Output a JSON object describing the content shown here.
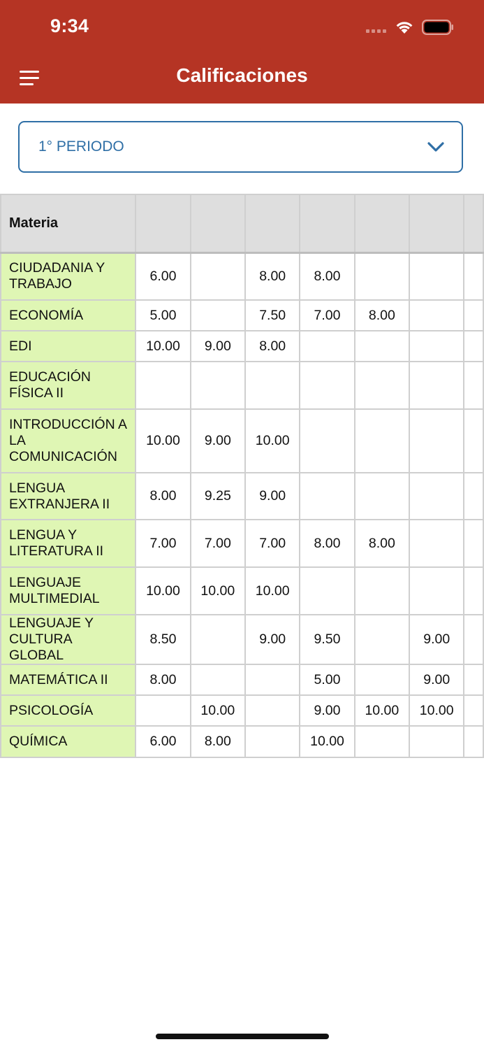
{
  "status_bar": {
    "time": "9:34"
  },
  "header": {
    "title": "Calificaciones",
    "menu_icon": "hamburger-menu-icon"
  },
  "period_select": {
    "selected": "1° PERIODO",
    "icon": "chevron-down-icon"
  },
  "table": {
    "header": [
      "Materia",
      "",
      "",
      "",
      "",
      "",
      ""
    ],
    "rows": [
      {
        "subject": "CIUDADANIA Y TRABAJO",
        "grades": [
          "6.00",
          "",
          "8.00",
          "8.00",
          "",
          ""
        ],
        "h": 68
      },
      {
        "subject": "ECONOMÍA",
        "grades": [
          "5.00",
          "",
          "7.50",
          "7.00",
          "8.00",
          ""
        ],
        "h": 44
      },
      {
        "subject": "EDI",
        "grades": [
          "10.00",
          "9.00",
          "8.00",
          "",
          "",
          ""
        ],
        "h": 44
      },
      {
        "subject": "EDUCACIÓN FÍSICA II",
        "grades": [
          "",
          "",
          "",
          "",
          "",
          ""
        ],
        "h": 68
      },
      {
        "subject": "INTRODUCCIÓN A LA COMUNICACIÓN",
        "grades": [
          "10.00",
          "9.00",
          "10.00",
          "",
          "",
          ""
        ],
        "h": 91
      },
      {
        "subject": "LENGUA EXTRANJERA II",
        "grades": [
          "8.00",
          "9.25",
          "9.00",
          "",
          "",
          ""
        ],
        "h": 67
      },
      {
        "subject": "LENGUA Y LITERATURA II",
        "grades": [
          "7.00",
          "7.00",
          "7.00",
          "8.00",
          "8.00",
          ""
        ],
        "h": 68
      },
      {
        "subject": "LENGUAJE MULTIMEDIAL",
        "grades": [
          "10.00",
          "10.00",
          "10.00",
          "",
          "",
          ""
        ],
        "h": 68
      },
      {
        "subject": "LENGUAJE Y CULTURA GLOBAL",
        "grades": [
          "8.50",
          "",
          "9.00",
          "9.50",
          "",
          "9.00"
        ],
        "h": 67
      },
      {
        "subject": "MATEMÁTICA II",
        "grades": [
          "8.00",
          "",
          "",
          "5.00",
          "",
          "9.00"
        ],
        "h": 44
      },
      {
        "subject": "PSICOLOGÍA",
        "grades": [
          "",
          "10.00",
          "",
          "9.00",
          "10.00",
          "10.00"
        ],
        "h": 44
      },
      {
        "subject": "QUÍMICA",
        "grades": [
          "6.00",
          "8.00",
          "",
          "10.00",
          "",
          ""
        ],
        "h": 45
      }
    ]
  }
}
